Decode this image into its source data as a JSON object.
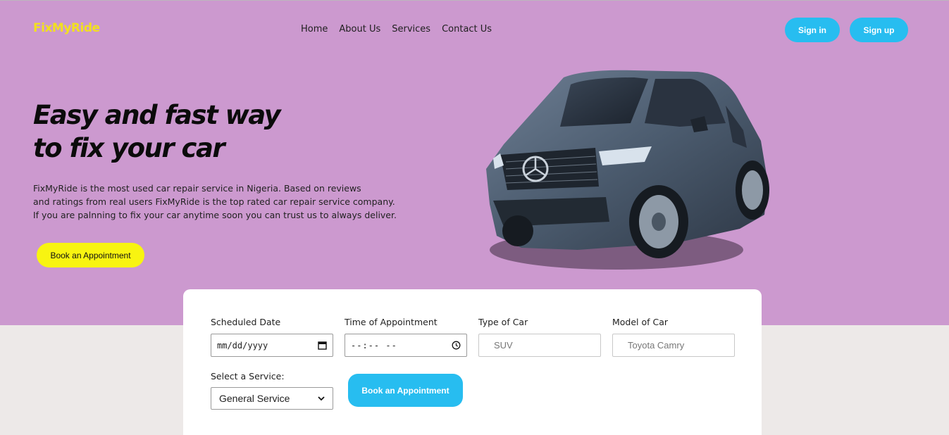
{
  "header": {
    "logo": "FixMyRide",
    "nav": [
      "Home",
      "About Us",
      "Services",
      "Contact Us"
    ],
    "sign_in": "Sign in",
    "sign_up": "Sign up"
  },
  "hero": {
    "headline_line1": "Easy and fast way",
    "headline_line2": "to fix your car",
    "desc_line1": "FixMyRide is the most used car repair service in Nigeria. Based on reviews",
    "desc_line2": "and ratings from real users FixMyRide is the top rated car repair service company.",
    "desc_line3": "If you are palnning to fix your car anytime soon you can trust us to always deliver.",
    "cta": "Book an Appointment",
    "image": "silver-suv-car-image"
  },
  "form": {
    "date_label": "Scheduled Date",
    "date_value": "mm/dd/yyyy",
    "time_label": "Time of Appointment",
    "time_value": "--:-- --",
    "car_type_label": "Type of Car",
    "car_type_placeholder": "SUV",
    "car_model_label": "Model of Car",
    "car_model_placeholder": "Toyota Camry",
    "service_label": "Select a Service:",
    "service_value": "General Service",
    "submit": "Book an Appointment"
  },
  "colors": {
    "hero_bg": "#cc99cf",
    "accent_blue": "#27bdf0",
    "accent_yellow": "#f8f411",
    "logo": "#f2e01f",
    "page_bg": "#ede9e8"
  },
  "icons": [
    "calendar-icon",
    "clock-icon",
    "chevron-down-icon"
  ]
}
